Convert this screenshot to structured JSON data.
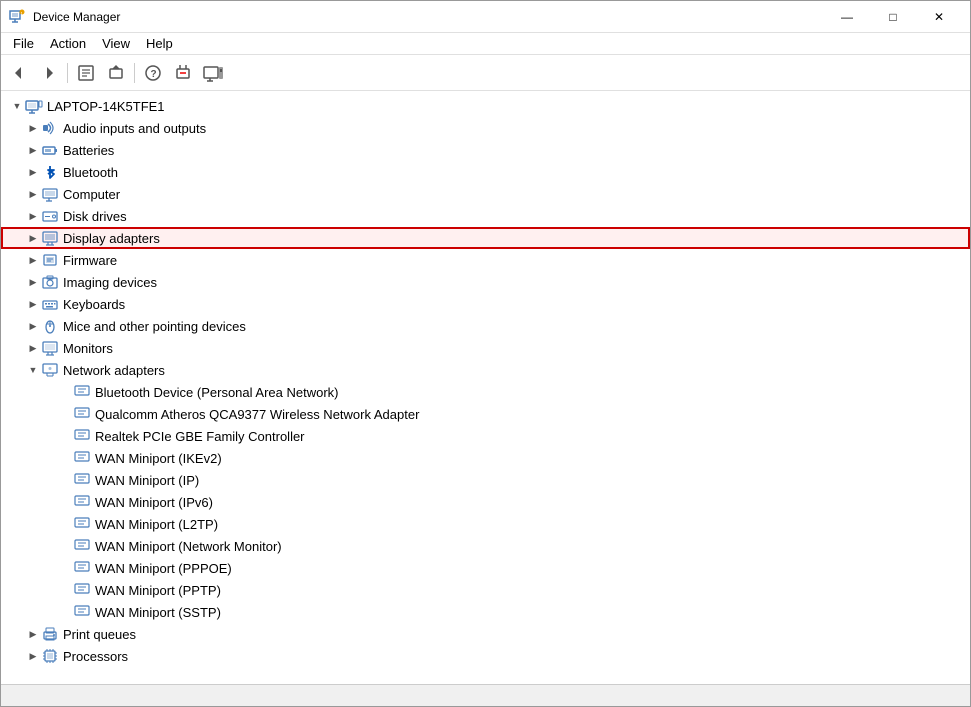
{
  "window": {
    "title": "Device Manager",
    "icon": "device-manager-icon"
  },
  "menu": {
    "items": [
      "File",
      "Action",
      "View",
      "Help"
    ]
  },
  "toolbar": {
    "buttons": [
      {
        "name": "back",
        "icon": "◀",
        "label": "Back"
      },
      {
        "name": "forward",
        "icon": "▶",
        "label": "Forward"
      },
      {
        "name": "properties",
        "icon": "📋",
        "label": "Properties"
      },
      {
        "name": "update-driver",
        "icon": "⬆",
        "label": "Update Driver"
      },
      {
        "name": "help",
        "icon": "?",
        "label": "Help"
      },
      {
        "name": "uninstall",
        "icon": "✕",
        "label": "Uninstall"
      },
      {
        "name": "show-hidden",
        "icon": "🖥",
        "label": "Show Hidden"
      }
    ]
  },
  "tree": {
    "root": {
      "label": "LAPTOP-14K5TFE1",
      "expanded": true,
      "children": [
        {
          "id": "audio",
          "label": "Audio inputs and outputs",
          "icon": "audio",
          "expanded": false,
          "indent": 1
        },
        {
          "id": "batteries",
          "label": "Batteries",
          "icon": "battery",
          "expanded": false,
          "indent": 1
        },
        {
          "id": "bluetooth",
          "label": "Bluetooth",
          "icon": "bluetooth",
          "expanded": false,
          "indent": 1
        },
        {
          "id": "computer",
          "label": "Computer",
          "icon": "computer",
          "expanded": false,
          "indent": 1
        },
        {
          "id": "disk",
          "label": "Disk drives",
          "icon": "disk",
          "expanded": false,
          "indent": 1
        },
        {
          "id": "display",
          "label": "Display adapters",
          "icon": "display",
          "expanded": false,
          "indent": 1,
          "highlighted": true
        },
        {
          "id": "firmware",
          "label": "Firmware",
          "icon": "firmware",
          "expanded": false,
          "indent": 1
        },
        {
          "id": "imaging",
          "label": "Imaging devices",
          "icon": "imaging",
          "expanded": false,
          "indent": 1
        },
        {
          "id": "keyboards",
          "label": "Keyboards",
          "icon": "keyboard",
          "expanded": false,
          "indent": 1
        },
        {
          "id": "mice",
          "label": "Mice and other pointing devices",
          "icon": "mouse",
          "expanded": false,
          "indent": 1
        },
        {
          "id": "monitors",
          "label": "Monitors",
          "icon": "monitor",
          "expanded": false,
          "indent": 1
        },
        {
          "id": "network",
          "label": "Network adapters",
          "icon": "network",
          "expanded": true,
          "indent": 1,
          "children": [
            {
              "id": "bt-net",
              "label": "Bluetooth Device (Personal Area Network)",
              "icon": "network-device",
              "indent": 2
            },
            {
              "id": "qualcomm",
              "label": "Qualcomm Atheros QCA9377 Wireless Network Adapter",
              "icon": "network-device",
              "indent": 2
            },
            {
              "id": "realtek",
              "label": "Realtek PCIe GBE Family Controller",
              "icon": "network-device",
              "indent": 2
            },
            {
              "id": "wan-ikev2",
              "label": "WAN Miniport (IKEv2)",
              "icon": "network-device",
              "indent": 2
            },
            {
              "id": "wan-ip",
              "label": "WAN Miniport (IP)",
              "icon": "network-device",
              "indent": 2
            },
            {
              "id": "wan-ipv6",
              "label": "WAN Miniport (IPv6)",
              "icon": "network-device",
              "indent": 2
            },
            {
              "id": "wan-l2tp",
              "label": "WAN Miniport (L2TP)",
              "icon": "network-device",
              "indent": 2
            },
            {
              "id": "wan-netmon",
              "label": "WAN Miniport (Network Monitor)",
              "icon": "network-device",
              "indent": 2
            },
            {
              "id": "wan-pppoe",
              "label": "WAN Miniport (PPPOE)",
              "icon": "network-device",
              "indent": 2
            },
            {
              "id": "wan-pptp",
              "label": "WAN Miniport (PPTP)",
              "icon": "network-device",
              "indent": 2
            },
            {
              "id": "wan-sstp",
              "label": "WAN Miniport (SSTP)",
              "icon": "network-device",
              "indent": 2
            }
          ]
        },
        {
          "id": "print",
          "label": "Print queues",
          "icon": "printer",
          "expanded": false,
          "indent": 1
        },
        {
          "id": "processors",
          "label": "Processors",
          "icon": "processor",
          "expanded": false,
          "indent": 1
        }
      ]
    }
  },
  "statusbar": {
    "text": ""
  }
}
